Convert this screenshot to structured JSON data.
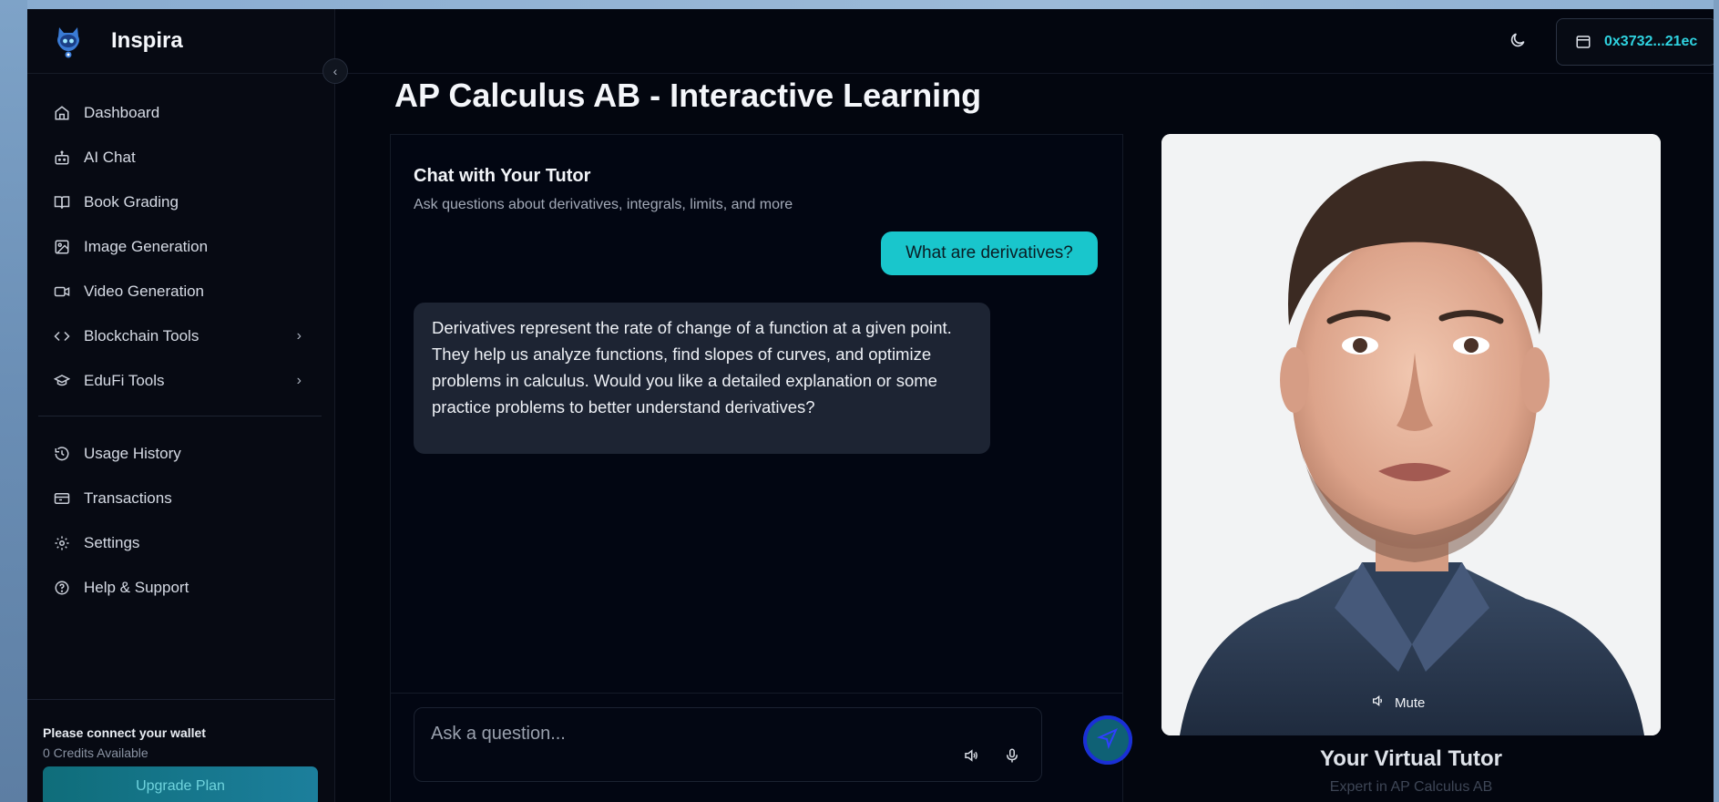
{
  "app": {
    "name": "Inspira"
  },
  "header": {
    "wallet_address": "0x3732...21ec"
  },
  "sidebar": {
    "items": [
      {
        "label": "Dashboard",
        "icon": "home-icon"
      },
      {
        "label": "AI Chat",
        "icon": "bot-icon"
      },
      {
        "label": "Book Grading",
        "icon": "book-open-icon"
      },
      {
        "label": "Image Generation",
        "icon": "image-icon"
      },
      {
        "label": "Video Generation",
        "icon": "video-icon"
      },
      {
        "label": "Blockchain Tools",
        "icon": "code-icon",
        "has_submenu": true
      },
      {
        "label": "EduFi Tools",
        "icon": "graduation-cap-icon",
        "has_submenu": true
      },
      {
        "label": "Usage History",
        "icon": "history-icon"
      },
      {
        "label": "Transactions",
        "icon": "receipt-icon"
      },
      {
        "label": "Settings",
        "icon": "gear-icon"
      },
      {
        "label": "Help & Support",
        "icon": "help-circle-icon"
      }
    ],
    "wallet": {
      "title": "Please connect your wallet",
      "credits": "0 Credits Available",
      "upgrade_label": "Upgrade Plan"
    }
  },
  "main": {
    "title": "AP Calculus AB - Interactive Learning",
    "chat": {
      "title": "Chat with Your Tutor",
      "subtitle": "Ask questions about derivatives, integrals, limits, and more",
      "messages": [
        {
          "role": "user",
          "text": "What are derivatives?"
        },
        {
          "role": "assistant",
          "text": "Derivatives represent the rate of change of a function at a given point. They help us analyze functions, find slopes of curves, and optimize problems in calculus. Would you like a detailed explanation or some practice problems to better understand derivatives?"
        }
      ],
      "input_placeholder": "Ask a question..."
    },
    "tutor": {
      "mute_label": "Mute",
      "name": "Your Virtual Tutor",
      "subtitle": "Expert in AP Calculus AB"
    }
  },
  "colors": {
    "accent": "#19c6cc",
    "background": "#03060f",
    "sidebar": "#070a13",
    "bubble": "#1d2433"
  }
}
